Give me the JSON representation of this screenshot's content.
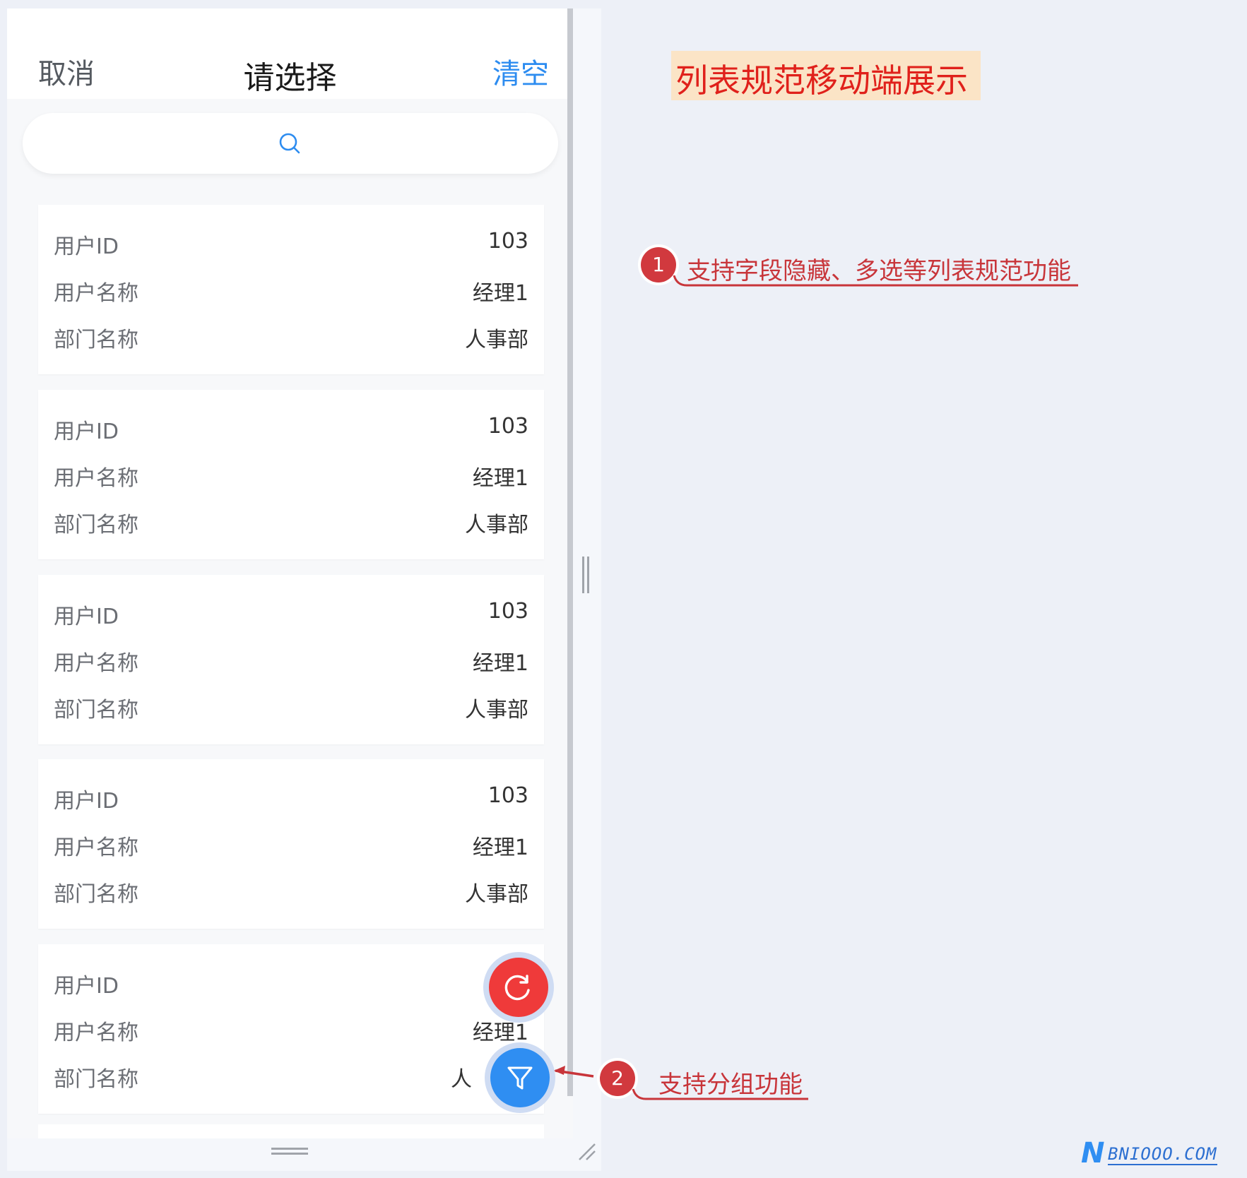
{
  "header": {
    "cancel_label": "取消",
    "title": "请选择",
    "clear_label": "清空"
  },
  "search": {
    "icon": "search-icon"
  },
  "cards": [
    {
      "fields": [
        {
          "label": "用户ID",
          "value": "103"
        },
        {
          "label": "用户名称",
          "value": "经理1"
        },
        {
          "label": "部门名称",
          "value": "人事部"
        }
      ]
    },
    {
      "fields": [
        {
          "label": "用户ID",
          "value": "103"
        },
        {
          "label": "用户名称",
          "value": "经理1"
        },
        {
          "label": "部门名称",
          "value": "人事部"
        }
      ]
    },
    {
      "fields": [
        {
          "label": "用户ID",
          "value": "103"
        },
        {
          "label": "用户名称",
          "value": "经理1"
        },
        {
          "label": "部门名称",
          "value": "人事部"
        }
      ]
    },
    {
      "fields": [
        {
          "label": "用户ID",
          "value": "103"
        },
        {
          "label": "用户名称",
          "value": "经理1"
        },
        {
          "label": "部门名称",
          "value": "人事部"
        }
      ]
    },
    {
      "fields": [
        {
          "label": "用户ID",
          "value": ""
        },
        {
          "label": "用户名称",
          "value": "经理1"
        },
        {
          "label": "部门名称",
          "value": "人"
        }
      ]
    }
  ],
  "fabs": {
    "refresh_icon": "refresh-icon",
    "filter_icon": "filter-icon"
  },
  "annotations": {
    "title": "列表规范移动端展示",
    "note1_number": "1",
    "note1_text": "支持字段隐藏、多选等列表规范功能",
    "note2_number": "2",
    "note2_text": "支持分组功能"
  },
  "watermark": {
    "text": "BNIOOO.COM",
    "letter": "N"
  },
  "colors": {
    "accent": "#2d8cf0",
    "refresh_fab": "#ef3a3a",
    "filter_fab": "#2f8ef2",
    "annotation": "#c8353a",
    "title_red": "#e0211b",
    "title_bg": "#fbe4c6"
  }
}
